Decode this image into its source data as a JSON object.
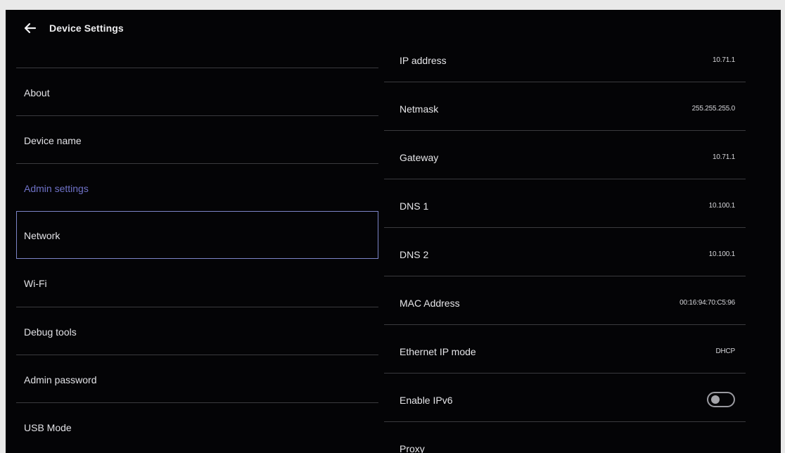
{
  "header": {
    "title": "Device Settings",
    "back_icon": "arrow-left-icon"
  },
  "menu": {
    "items": [
      {
        "label": "About"
      },
      {
        "label": "Device name"
      },
      {
        "label": "Admin settings"
      },
      {
        "label": "Network"
      },
      {
        "label": "Wi-Fi"
      },
      {
        "label": "Debug tools"
      },
      {
        "label": "Admin password"
      },
      {
        "label": "USB Mode"
      }
    ],
    "highlight_color": "#6f72c8",
    "selected_border_color": "#7d85c8"
  },
  "details": {
    "rows": [
      {
        "label": "IP address",
        "value": "10.71.1"
      },
      {
        "label": "Netmask",
        "value": "255.255.255.0"
      },
      {
        "label": "Gateway",
        "value": "10.71.1"
      },
      {
        "label": "DNS 1",
        "value": "10.100.1"
      },
      {
        "label": "DNS 2",
        "value": "10.100.1"
      },
      {
        "label": "MAC Address",
        "value": "00:16:94:70:C5:96"
      },
      {
        "label": "Ethernet IP mode",
        "value": "DHCP"
      },
      {
        "label": "Enable IPv6",
        "toggle": false
      },
      {
        "label": "Proxy"
      }
    ]
  }
}
